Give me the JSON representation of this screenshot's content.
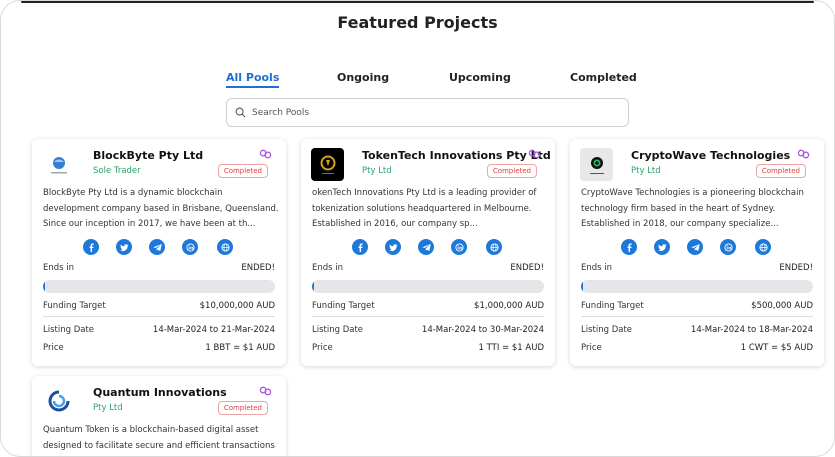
{
  "page_title": "Featured Projects",
  "tabs": [
    {
      "label": "All Pools",
      "active": true
    },
    {
      "label": "Ongoing",
      "active": false
    },
    {
      "label": "Upcoming",
      "active": false
    },
    {
      "label": "Completed",
      "active": false
    }
  ],
  "search": {
    "placeholder": "Search Pools"
  },
  "labels": {
    "ends_in": "Ends in",
    "funding_target": "Funding Target",
    "listing_date": "Listing Date",
    "price": "Price"
  },
  "colors": {
    "accent": "#1e78d9",
    "status_completed": "#e04141",
    "entity_type": "#2aa36b"
  },
  "projects": [
    {
      "name": "BlockByte Pty Ltd",
      "type": "Sole Trader",
      "status": "Completed",
      "logo": "blockbyte-globe-logo",
      "description": "BlockByte Pty Ltd is a dynamic blockchain development company based in Brisbane, Queensland. Since our inception in 2017, we have been at th...",
      "ends_in_value": "ENDED!",
      "progress": 0.01,
      "funding_target": "$10,000,000 AUD",
      "listing_date": "14-Mar-2024 to 21-Mar-2024",
      "price": "1 BBT = $1 AUD"
    },
    {
      "name": "TokenTech Innovations Pty Ltd",
      "type": "Pty Ltd",
      "status": "Completed",
      "logo": "tokentech-gold-coin-logo",
      "description": "okenTech Innovations Pty Ltd is a leading provider of tokenization solutions headquartered in Melbourne. Established in 2016, our company sp...",
      "ends_in_value": "ENDED!",
      "progress": 0.01,
      "funding_target": "$1,000,000 AUD",
      "listing_date": "14-Mar-2024 to 30-Mar-2024",
      "price": "1 TTI = $1 AUD"
    },
    {
      "name": "CryptoWave Technologies",
      "type": "Pty Ltd",
      "status": "Completed",
      "logo": "cryptowave-ring-logo",
      "description": "CryptoWave Technologies is a pioneering blockchain technology firm based in the heart of Sydney. Established in 2018, our company specialize...",
      "ends_in_value": "ENDED!",
      "progress": 0.01,
      "funding_target": "$500,000 AUD",
      "listing_date": "14-Mar-2024 to 18-Mar-2024",
      "price": "1 CWT = $5 AUD"
    },
    {
      "name": "Quantum Innovations",
      "type": "Pty Ltd",
      "status": "Completed",
      "logo": "quantum-swirl-logo",
      "description": "Quantum Token is a blockchain-based digital asset designed to facilitate secure and efficient transactions"
    }
  ],
  "social_icons": [
    "facebook-icon",
    "twitter-icon",
    "telegram-icon",
    "linkedin-icon",
    "website-icon"
  ]
}
